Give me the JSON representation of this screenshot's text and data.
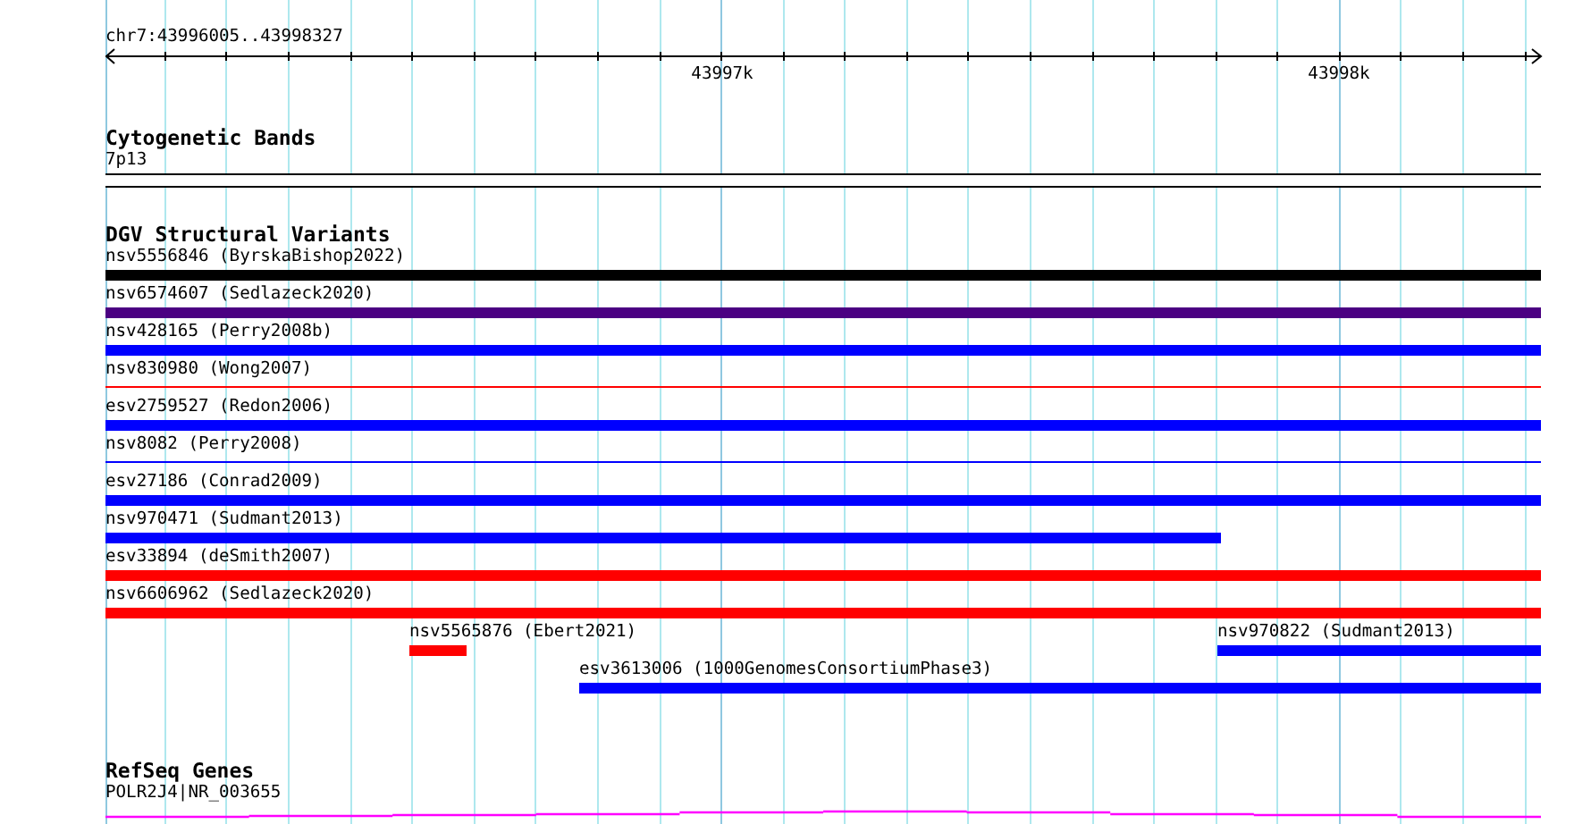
{
  "ruler": {
    "label": "chr7:43996005..43998327",
    "ticks": [
      {
        "label": "43997k"
      },
      {
        "label": "43998k"
      }
    ]
  },
  "tracks": [
    {
      "kind": "cytoband",
      "title": "Cytogenetic Bands",
      "lanes": [
        [
          {
            "label": "7p13",
            "color": "#ffffff",
            "kind": "band"
          }
        ]
      ]
    },
    {
      "kind": "variants",
      "title": "DGV Structural Variants",
      "lanes": [
        [
          {
            "label": "nsv5556846 (ByrskaBishop2022)",
            "color": "#000000",
            "kind": "thick"
          }
        ],
        [
          {
            "label": "nsv6574607 (Sedlazeck2020)",
            "color": "#4b0082",
            "kind": "thick"
          }
        ],
        [
          {
            "label": "nsv428165 (Perry2008b)",
            "color": "#0000ff",
            "kind": "thick"
          }
        ],
        [
          {
            "label": "nsv830980 (Wong2007)",
            "color": "#ff0000",
            "kind": "thin"
          }
        ],
        [
          {
            "label": "esv2759527 (Redon2006)",
            "color": "#0000ff",
            "kind": "thick"
          }
        ],
        [
          {
            "label": "nsv8082 (Perry2008)",
            "color": "#0000ff",
            "kind": "thin"
          }
        ],
        [
          {
            "label": "esv27186 (Conrad2009)",
            "color": "#0000ff",
            "kind": "thick"
          }
        ],
        [
          {
            "label": "nsv970471 (Sudmant2013)",
            "color": "#0000ff",
            "kind": "thick"
          }
        ],
        [
          {
            "label": "esv33894 (deSmith2007)",
            "color": "#ff0000",
            "kind": "thick"
          }
        ],
        [
          {
            "label": "nsv6606962 (Sedlazeck2020)",
            "color": "#ff0000",
            "kind": "thick"
          }
        ],
        [
          {
            "label": "nsv5565876 (Ebert2021)",
            "color": "#ff0000",
            "kind": "thick"
          },
          {
            "label": "nsv970822 (Sudmant2013)",
            "color": "#0000ff",
            "kind": "thick"
          }
        ],
        [
          {
            "label": "esv3613006 (1000GenomesConsortiumPhase3)",
            "color": "#0000ff",
            "kind": "thick"
          }
        ]
      ]
    },
    {
      "kind": "genes",
      "title": "RefSeq Genes",
      "lanes": [
        [
          {
            "label": "POLR2J4|NR_003655",
            "color": "#ff00ff",
            "kind": "gene"
          }
        ]
      ]
    }
  ]
}
